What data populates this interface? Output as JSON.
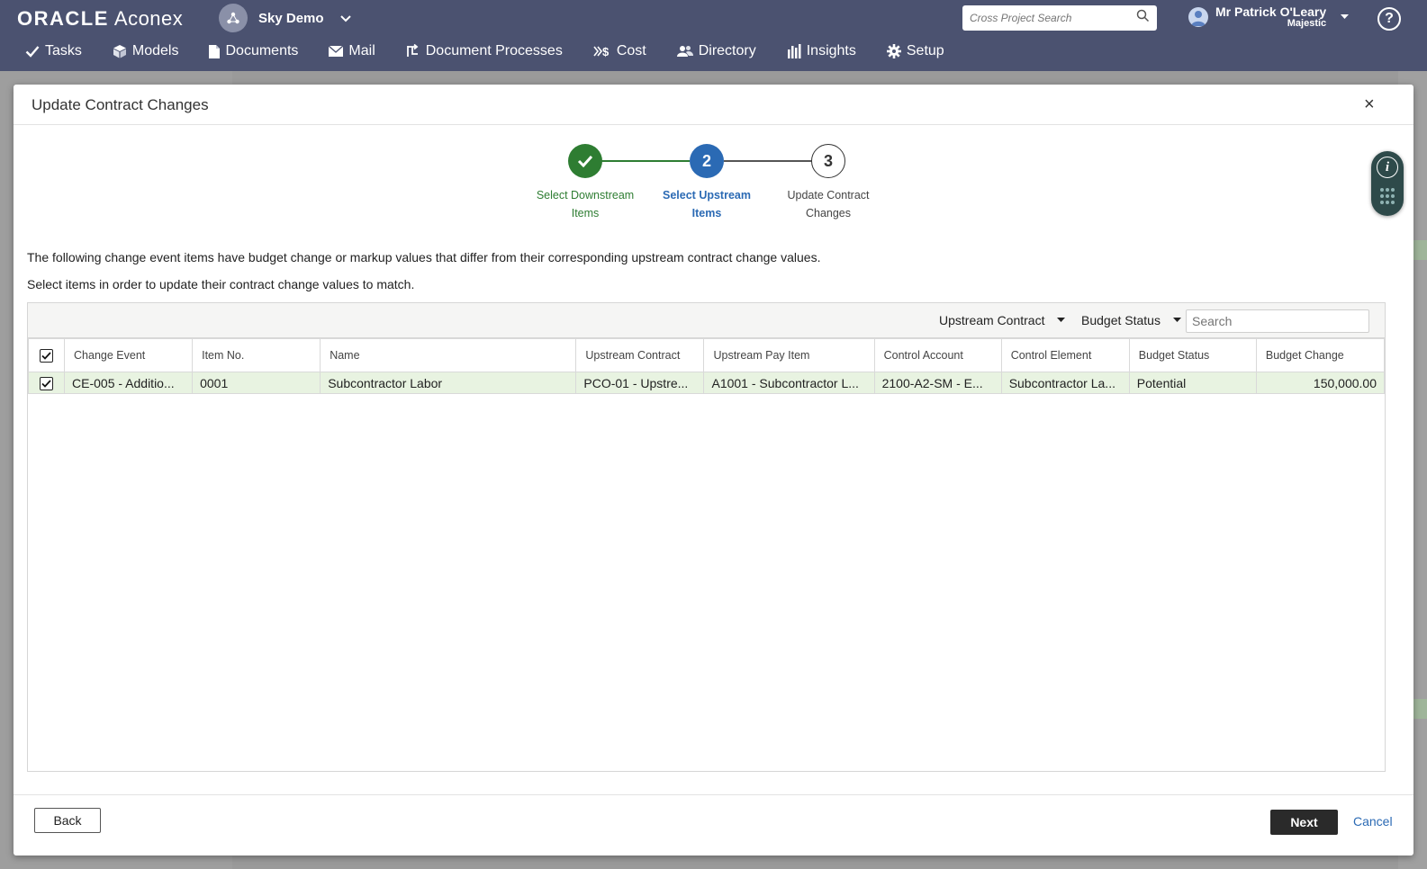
{
  "header": {
    "brand_oracle": "ORACLE",
    "brand_aconex": "Aconex",
    "project_name": "Sky Demo",
    "cross_search_placeholder": "Cross Project Search",
    "user_name": "Mr Patrick O'Leary",
    "user_org": "Majestic",
    "help_label": "?"
  },
  "nav": {
    "items": [
      {
        "label": "Tasks",
        "icon": "check-icon"
      },
      {
        "label": "Models",
        "icon": "cube-icon"
      },
      {
        "label": "Documents",
        "icon": "document-icon"
      },
      {
        "label": "Mail",
        "icon": "mail-icon"
      },
      {
        "label": "Document Processes",
        "icon": "workflow-icon"
      },
      {
        "label": "Cost",
        "icon": "cost-icon"
      },
      {
        "label": "Directory",
        "icon": "people-icon"
      },
      {
        "label": "Insights",
        "icon": "bar-chart-icon"
      },
      {
        "label": "Setup",
        "icon": "gear-icon"
      }
    ]
  },
  "modal": {
    "title": "Update Contract Changes",
    "close_label": "×",
    "steps": [
      {
        "number": "1",
        "line1": "Select Downstream",
        "line2": "Items",
        "state": "done"
      },
      {
        "number": "2",
        "line1": "Select Upstream",
        "line2": "Items",
        "state": "active"
      },
      {
        "number": "3",
        "line1": "Update Contract",
        "line2": "Changes",
        "state": "todo"
      }
    ],
    "info_label": "i",
    "description_1": "The following change event items have budget change or markup values that differ from their corresponding upstream contract change values.",
    "description_2": "Select items in order to update their contract change values to match.",
    "toolbar": {
      "filter_upstream": "Upstream Contract",
      "filter_budget": "Budget Status",
      "search_placeholder": "Search"
    },
    "table": {
      "columns": [
        "Change Event",
        "Item No.",
        "Name",
        "Upstream Contract",
        "Upstream Pay Item",
        "Control Account",
        "Control Element",
        "Budget Status",
        "Budget Change"
      ],
      "rows": [
        [
          "CE-005 - Additio...",
          "0001",
          "Subcontractor Labor",
          "PCO-01 - Upstre...",
          "A1001 - Subcontractor L...",
          "2100-A2-SM - E...",
          "Subcontractor La...",
          "Potential",
          "150,000.00"
        ]
      ]
    },
    "footer": {
      "back_label": "Back",
      "next_label": "Next",
      "cancel_label": "Cancel"
    }
  },
  "colors": {
    "header_bg": "#4b5270",
    "step_done": "#2e7d32",
    "step_active": "#2b6ab4",
    "selected_row": "#e8f3e1",
    "next_button": "#2a2a2a",
    "link": "#2b6ab4"
  }
}
